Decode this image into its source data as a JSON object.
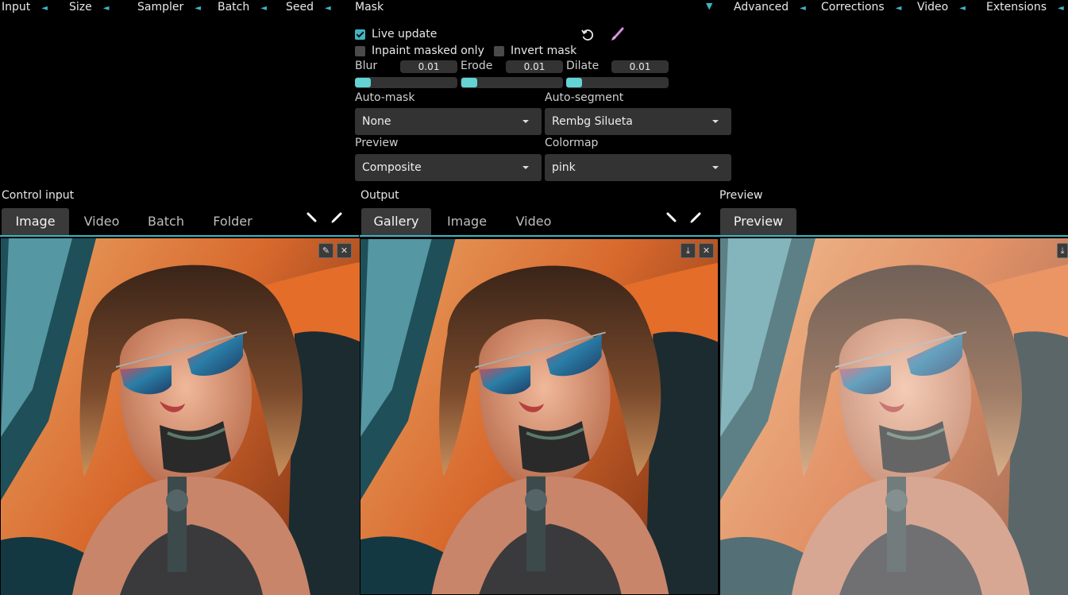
{
  "accordion": {
    "input": "Input",
    "size": "Size",
    "sampler": "Sampler",
    "batch": "Batch",
    "seed": "Seed",
    "mask": "Mask",
    "advanced": "Advanced",
    "corrections": "Corrections",
    "video": "Video",
    "extensions": "Extensions",
    "collapsed_arrow": "◄",
    "expanded_arrow": "▼"
  },
  "mask": {
    "live_update": {
      "label": "Live update",
      "checked": true
    },
    "inpaint_masked_only": {
      "label": "Inpaint masked only",
      "checked": false
    },
    "invert_mask": {
      "label": "Invert mask",
      "checked": false
    },
    "blur": {
      "label": "Blur",
      "value": "0.01"
    },
    "erode": {
      "label": "Erode",
      "value": "0.01"
    },
    "dilate": {
      "label": "Dilate",
      "value": "0.01"
    },
    "auto_mask": {
      "label": "Auto-mask",
      "value": "None"
    },
    "auto_segment": {
      "label": "Auto-segment",
      "value": "Rembg Silueta"
    },
    "preview": {
      "label": "Preview",
      "value": "Composite"
    },
    "colormap": {
      "label": "Colormap",
      "value": "pink"
    },
    "icons": [
      "reset-icon",
      "brush-icon"
    ]
  },
  "control_input": {
    "title": "Control input",
    "tabs": [
      "Image",
      "Video",
      "Batch",
      "Folder"
    ],
    "active_tab": "Image",
    "buttons": {
      "edit": "✎",
      "close": "✕"
    }
  },
  "output": {
    "title": "Output",
    "tabs": [
      "Gallery",
      "Image",
      "Video"
    ],
    "active_tab": "Gallery",
    "buttons": {
      "download": "⤓",
      "close": "✕"
    }
  },
  "preview": {
    "title": "Preview",
    "tabs": [
      "Preview"
    ],
    "active_tab": "Preview",
    "buttons": {
      "download": "⤓"
    }
  },
  "colors": {
    "accent": "#3fb5c4",
    "slider_thumb": "#63d3d6",
    "input_bg": "#333333",
    "tab_active_bg": "#3a3a3a"
  }
}
